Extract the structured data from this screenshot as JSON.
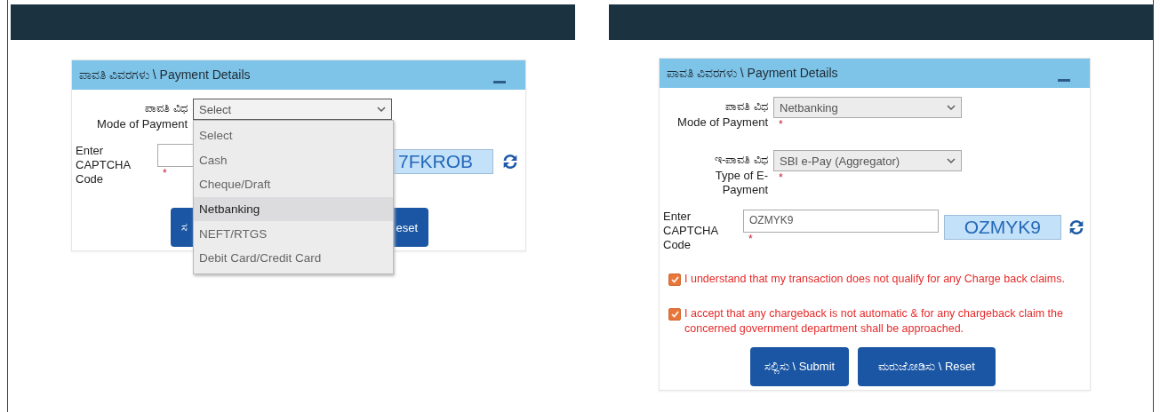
{
  "panels": [
    {
      "card_title": "ಪಾವತಿ ವಿವರಗಳು \\ Payment Details",
      "fields": [
        {
          "kind": "select",
          "label_local": "ಪಾವತಿ ವಿಧ",
          "label": "Mode of Payment",
          "value": "Select",
          "open": true,
          "options": [
            {
              "label": "Select",
              "highlighted": false
            },
            {
              "label": "Cash",
              "highlighted": false
            },
            {
              "label": "Cheque/Draft",
              "highlighted": false
            },
            {
              "label": "Netbanking",
              "highlighted": true
            },
            {
              "label": "NEFT/RTGS",
              "highlighted": false
            },
            {
              "label": "Debit Card/Credit Card",
              "highlighted": false
            }
          ]
        }
      ],
      "captcha": {
        "label": "Enter CAPTCHA Code",
        "required_mark": "*",
        "code": "7FKROB"
      },
      "buttons": [
        {
          "kind": "submit",
          "label": "ಸ"
        },
        {
          "kind": "reset",
          "label": "eset"
        }
      ]
    },
    {
      "card_title": "ಪಾವತಿ ವಿವರಗಳು \\ Payment Details",
      "fields": [
        {
          "kind": "select",
          "label_local": "ಪಾವತಿ ವಿಧ",
          "label": "Mode of Payment",
          "value": "Netbanking",
          "required_mark": "*",
          "open": false
        },
        {
          "kind": "select",
          "label_local": "ಇ-ಪಾವತಿ ವಿಧ",
          "label": "Type of E-Payment",
          "value": "SBI e-Pay (Aggregator)",
          "required_mark": "*",
          "open": false
        }
      ],
      "captcha": {
        "label": "Enter CAPTCHA Code",
        "value": "OZMYK9",
        "required_mark": "*",
        "code": "OZMYK9"
      },
      "checks": [
        {
          "label": "I understand that my transaction does not qualify for any Charge back claims.",
          "checked": true
        },
        {
          "label": "I accept that any chargeback is not automatic & for any chargeback claim the concerned government department shall be approached.",
          "checked": true
        }
      ],
      "buttons": [
        {
          "kind": "submit",
          "label": "ಸಲ್ಲಿಸು \\ Submit"
        },
        {
          "kind": "reset",
          "label": "ಮರುಜೋಡಿಸು \\ Reset"
        }
      ]
    }
  ]
}
